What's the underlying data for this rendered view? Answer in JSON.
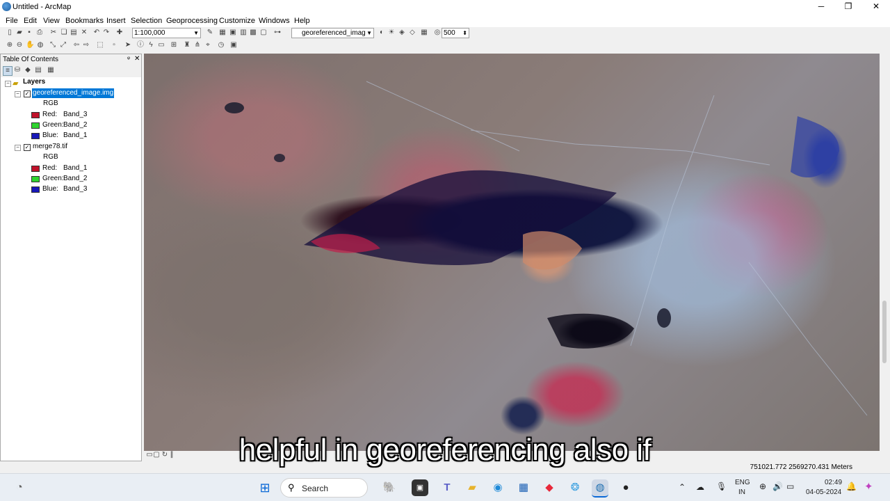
{
  "window": {
    "title": "Untitled - ArcMap",
    "minimize_glyph": "─",
    "maximize_glyph": "❐",
    "close_glyph": "✕"
  },
  "menu": [
    "File",
    "Edit",
    "View",
    "Bookmarks",
    "Insert",
    "Selection",
    "Geoprocessing",
    "Customize",
    "Windows",
    "Help"
  ],
  "toolbar": {
    "scale_value": "1:100,000",
    "layer_combo_value": "georeferenced_imag",
    "resolution_value": "500"
  },
  "toc": {
    "title": "Table Of Contents",
    "pin_glyph": "ᵠ",
    "close_glyph": "✕",
    "root": "Layers",
    "layers": [
      {
        "name": "georeferenced_image.img",
        "selected": true,
        "checked": true,
        "renderer": "RGB",
        "bands": [
          {
            "label": "Red:",
            "band": "Band_3",
            "color": "#c0122b"
          },
          {
            "label": "Green:",
            "band": "Band_2",
            "color": "#2fd42f"
          },
          {
            "label": "Blue:",
            "band": "Band_1",
            "color": "#1818b8"
          }
        ]
      },
      {
        "name": "merge78.tif",
        "selected": false,
        "checked": true,
        "renderer": "RGB",
        "bands": [
          {
            "label": "Red:",
            "band": "Band_1",
            "color": "#c0122b"
          },
          {
            "label": "Green:",
            "band": "Band_2",
            "color": "#2fd42f"
          },
          {
            "label": "Blue:",
            "band": "Band_3",
            "color": "#1818b8"
          }
        ]
      }
    ]
  },
  "status": {
    "coordinates": "751021.772  2569270.431 Meters"
  },
  "subtitle": "helpful in georeferencing also if",
  "taskbar": {
    "search_label": "Search",
    "language_top": "ENG",
    "language_bottom": "IN",
    "time": "02:49",
    "date": "04-05-2024"
  }
}
